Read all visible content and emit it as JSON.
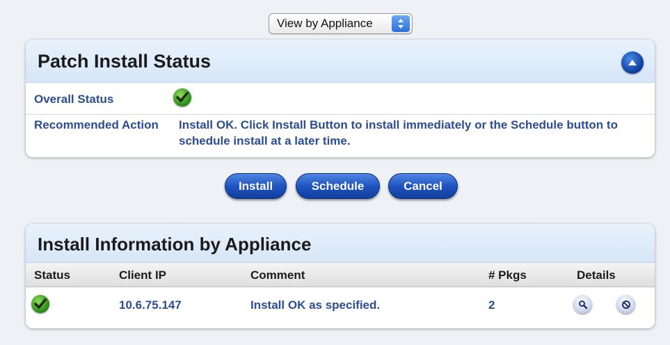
{
  "view_select": {
    "selected": "View by Appliance"
  },
  "patch_status": {
    "title": "Patch Install Status",
    "overall_status_label": "Overall Status",
    "recommended_action_label": "Recommended Action",
    "recommended_action_text": "Install OK. Click Install Button to install immediately or the Schedule button to schedule install at a later time."
  },
  "actions": {
    "install": "Install",
    "schedule": "Schedule",
    "cancel": "Cancel"
  },
  "install_info": {
    "title": "Install Information by Appliance",
    "columns": [
      "Status",
      "Client IP",
      "Comment",
      "# Pkgs",
      "Details"
    ],
    "rows": [
      {
        "status": "ok",
        "client_ip": "10.6.75.147",
        "comment": "Install OK as specified.",
        "pkgs": "2"
      }
    ]
  },
  "icons": {
    "status_ok": "check-icon",
    "collapse": "chevron-up-icon",
    "details_view": "magnifier-icon",
    "details_cancel": "no-entry-icon"
  },
  "colors": {
    "accent_blue": "#1f53bf",
    "label_blue": "#2b4d93",
    "panel_header": "#dce9f9",
    "ok_green": "#2d8e1a"
  }
}
